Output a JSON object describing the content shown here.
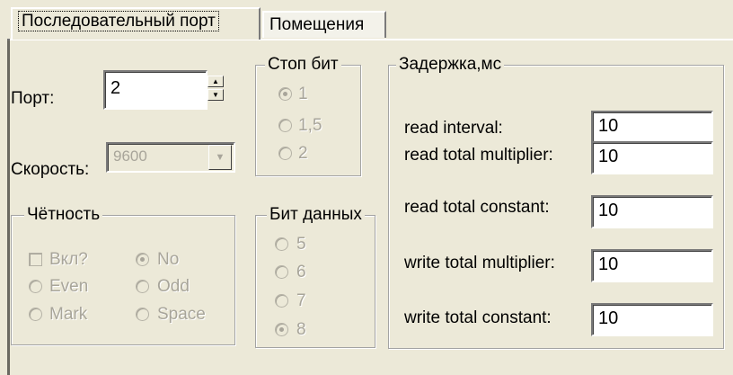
{
  "tabs": [
    {
      "label": "Последовательный порт"
    },
    {
      "label": "Помещения"
    }
  ],
  "port": {
    "label": "Порт:",
    "value": "2"
  },
  "speed": {
    "label": "Скорость:",
    "value": "9600"
  },
  "stop_bits": {
    "legend": "Стоп бит",
    "options": [
      {
        "label": "1",
        "checked": true
      },
      {
        "label": "1,5",
        "checked": false
      },
      {
        "label": "2",
        "checked": false
      }
    ]
  },
  "parity": {
    "legend": "Чётность",
    "enable_label": "Вкл?",
    "options": [
      "No",
      "Even",
      "Odd",
      "Mark",
      "Space"
    ]
  },
  "data_bits": {
    "legend": "Бит данных",
    "options": [
      {
        "label": "5",
        "checked": false
      },
      {
        "label": "6",
        "checked": false
      },
      {
        "label": "7",
        "checked": false
      },
      {
        "label": "8",
        "checked": true
      }
    ]
  },
  "delay": {
    "legend": "Задержка,мс",
    "fields": [
      {
        "label": "read interval:",
        "value": "10"
      },
      {
        "label": "read total multiplier:",
        "value": "10"
      },
      {
        "label": "read total constant:",
        "value": "10"
      },
      {
        "label": "write total multiplier:",
        "value": "10"
      },
      {
        "label": "write total constant:",
        "value": "10"
      }
    ]
  }
}
